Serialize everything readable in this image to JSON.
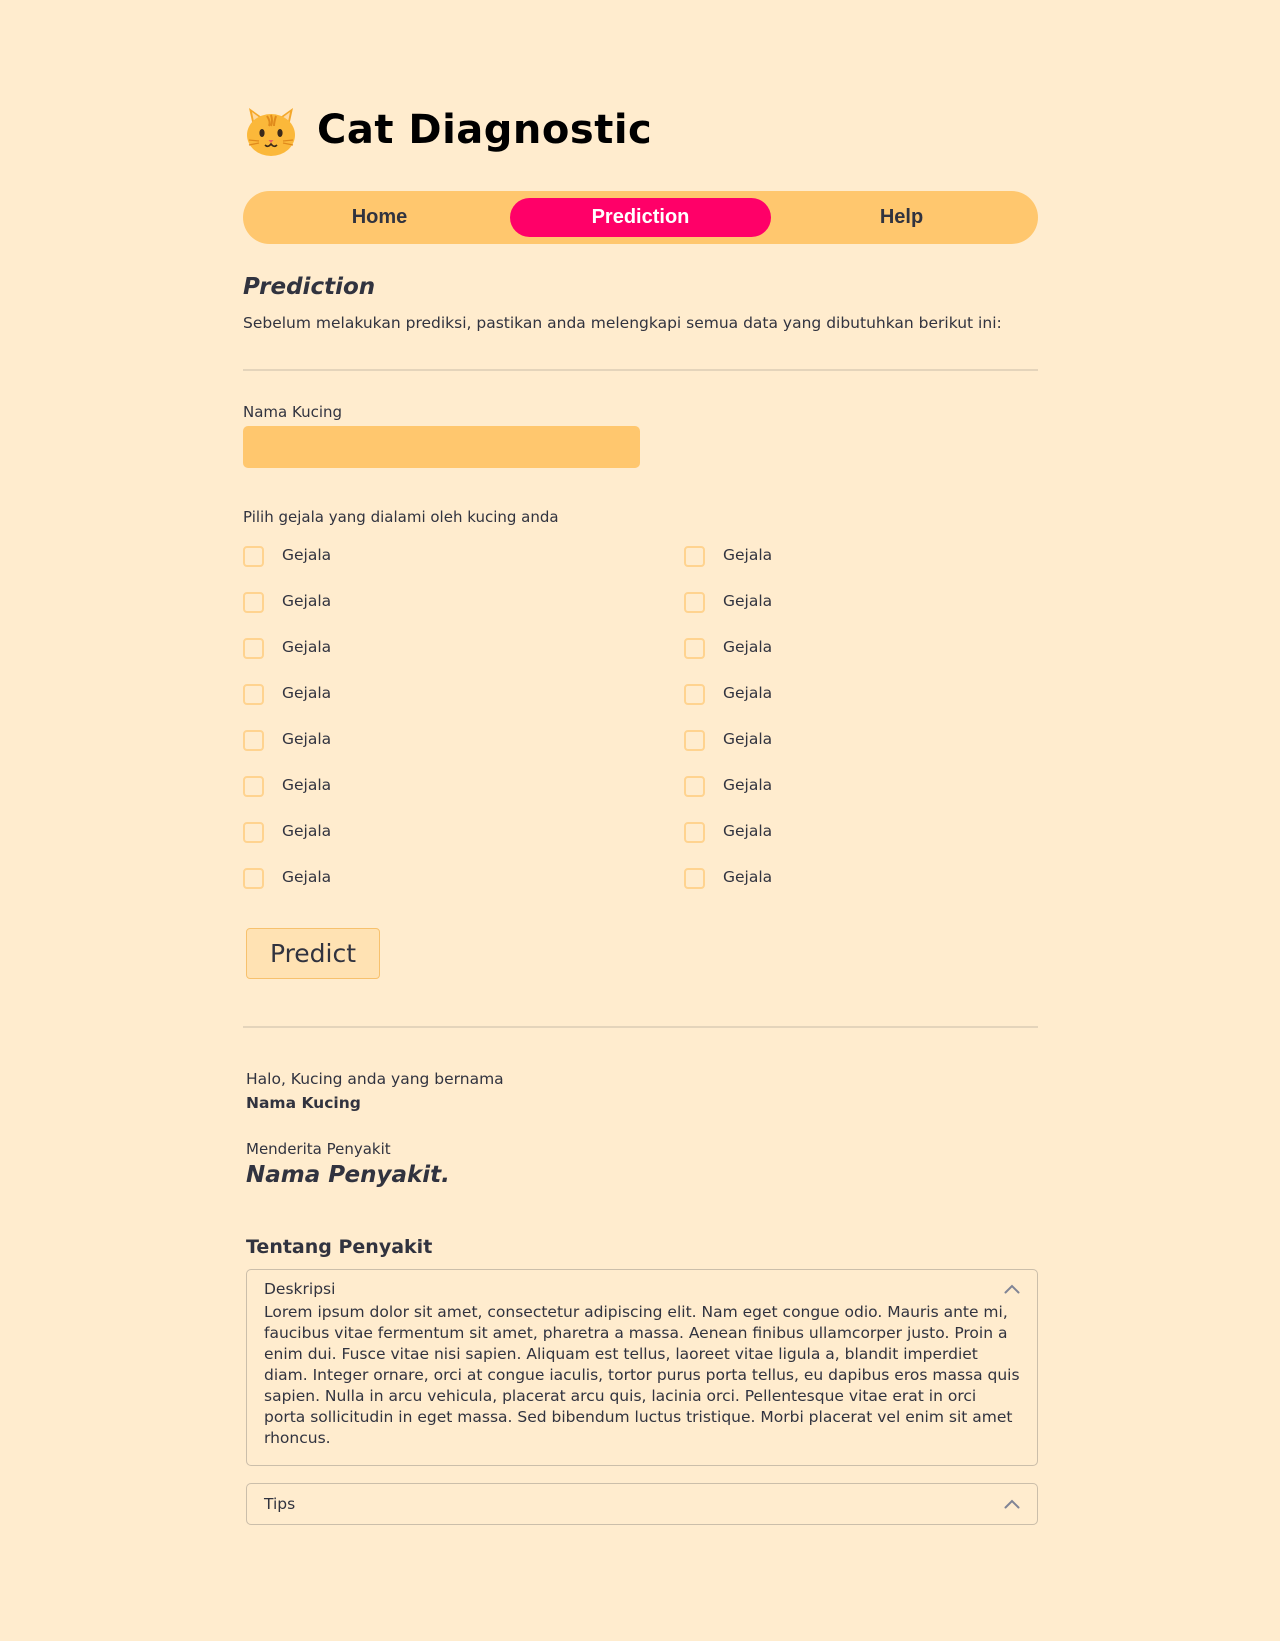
{
  "app": {
    "title": "Cat Diagnostic",
    "icon": "cat-face-icon"
  },
  "nav": {
    "items": [
      {
        "label": "Home",
        "active": false
      },
      {
        "label": "Prediction",
        "active": true
      },
      {
        "label": "Help",
        "active": false
      }
    ],
    "active_color": "#ff0068",
    "bar_color": "#ffc76e"
  },
  "prediction": {
    "title": "Prediction",
    "intro": "Sebelum melakukan prediksi, pastikan anda melengkapi semua data yang dibutuhkan berikut ini:",
    "name_label": "Nama Kucing",
    "name_value": "",
    "symptom_label": "Pilih gejala yang dialami oleh kucing anda",
    "symptoms": [
      {
        "label": "Gejala",
        "checked": false
      },
      {
        "label": "Gejala",
        "checked": false
      },
      {
        "label": "Gejala",
        "checked": false
      },
      {
        "label": "Gejala",
        "checked": false
      },
      {
        "label": "Gejala",
        "checked": false
      },
      {
        "label": "Gejala",
        "checked": false
      },
      {
        "label": "Gejala",
        "checked": false
      },
      {
        "label": "Gejala",
        "checked": false
      },
      {
        "label": "Gejala",
        "checked": false
      },
      {
        "label": "Gejala",
        "checked": false
      },
      {
        "label": "Gejala",
        "checked": false
      },
      {
        "label": "Gejala",
        "checked": false
      },
      {
        "label": "Gejala",
        "checked": false
      },
      {
        "label": "Gejala",
        "checked": false
      },
      {
        "label": "Gejala",
        "checked": false
      },
      {
        "label": "Gejala",
        "checked": false
      }
    ],
    "predict_button": "Predict"
  },
  "result": {
    "greeting": "Halo, Kucing anda yang bernama",
    "cat_name": "Nama Kucing",
    "disease_label": "Menderita Penyakit",
    "disease_name": "Nama Penyakit.",
    "about_title": "Tentang Penyakit",
    "description": {
      "title": "Deskripsi",
      "expanded": true,
      "text": "Lorem ipsum dolor sit amet, consectetur adipiscing elit. Nam eget congue odio. Mauris ante mi, faucibus vitae fermentum sit amet, pharetra a massa. Aenean finibus ullamcorper justo. Proin a enim dui. Fusce vitae nisi sapien. Aliquam est tellus, laoreet vitae ligula a, blandit imperdiet diam. Integer ornare, orci at congue iaculis, tortor purus porta tellus, eu dapibus eros massa quis sapien. Nulla in arcu vehicula, placerat arcu quis, lacinia orci. Pellentesque vitae erat in orci porta sollicitudin in eget massa. Sed bibendum luctus tristique. Morbi placerat vel enim sit amet rhoncus."
    },
    "tips": {
      "title": "Tips",
      "expanded": false
    }
  }
}
